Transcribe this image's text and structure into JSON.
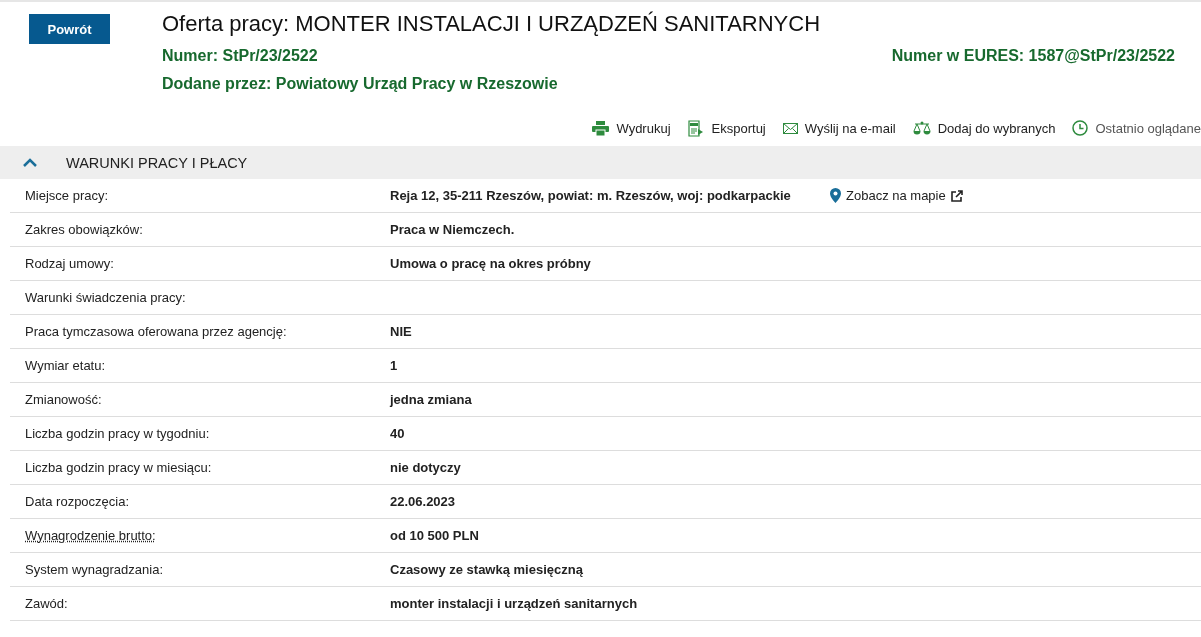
{
  "back_button": "Powrót",
  "title": "Oferta pracy: MONTER INSTALACJI I URZĄDZEŃ SANITARNYCH",
  "number": {
    "label": "Numer:",
    "value": "StPr/23/2522"
  },
  "eures_number": {
    "label": "Numer w EURES:",
    "value": "1587@StPr/23/2522"
  },
  "added_by": {
    "label": "Dodane przez:",
    "value": "Powiatowy Urząd Pracy w Rzeszowie"
  },
  "toolbar": [
    {
      "kind": "print",
      "label": "Wydrukuj"
    },
    {
      "kind": "pdf",
      "label": "Eksportuj"
    },
    {
      "kind": "mail",
      "label": "Wyślij na e-mail"
    },
    {
      "kind": "favorites",
      "label": "Dodaj do wybranych"
    },
    {
      "kind": "history",
      "label": "Ostatnio oglądane"
    }
  ],
  "section": {
    "title": "WARUNKI PRACY I PŁACY",
    "expanded": true,
    "rows": [
      {
        "label": "Miejsce pracy:",
        "value": "Reja 12, 35-211 Rzeszów, powiat: m. Rzeszów, woj: podkarpackie",
        "link": "Zobacz na mapie",
        "hint": false
      },
      {
        "label": "Zakres obowiązków:",
        "value": "Praca w Niemczech.",
        "hint": false
      },
      {
        "label": "Rodzaj umowy:",
        "value": "Umowa o pracę na okres próbny",
        "hint": false
      },
      {
        "label": "Warunki świadczenia pracy:",
        "hint": false
      },
      {
        "label": "Praca tymczasowa oferowana przez agencję:",
        "value": "NIE",
        "hint": false
      },
      {
        "label": "Wymiar etatu:",
        "value": "1",
        "hint": false
      },
      {
        "label": "Zmianowość:",
        "value": "jedna zmiana",
        "hint": false
      },
      {
        "label": "Liczba godzin pracy w tygodniu:",
        "value": "40",
        "hint": false
      },
      {
        "label": "Liczba godzin pracy w miesiącu:",
        "value": "nie dotyczy",
        "hint": false
      },
      {
        "label": "Data rozpoczęcia:",
        "value": "22.06.2023",
        "hint": false
      },
      {
        "label": "Wynagrodzenie brutto:",
        "value": "od 10 500 PLN",
        "hint": true
      },
      {
        "label": "System wynagradzania:",
        "value": "Czasowy ze stawką miesięczną",
        "hint": false
      },
      {
        "label": "Zawód:",
        "value": "monter instalacji i urządzeń sanitarnych",
        "hint": false
      }
    ]
  }
}
